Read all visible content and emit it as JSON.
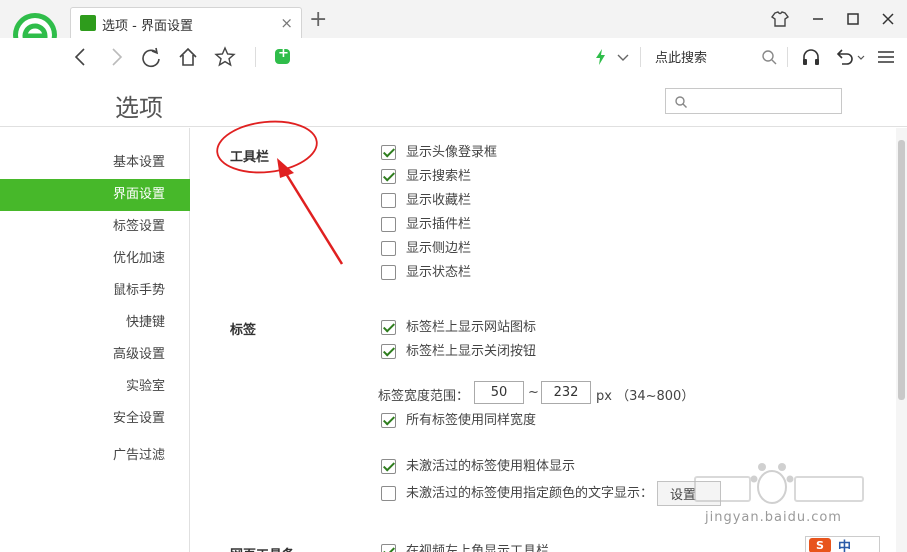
{
  "browser": {
    "tab_title": "选项 - 界面设置",
    "tab_close": "×",
    "new_tab": "+",
    "search_hint": "点此搜索"
  },
  "page": {
    "title": "选项",
    "search_placeholder": ""
  },
  "sidebar": {
    "items": [
      {
        "label": "基本设置",
        "active": false
      },
      {
        "label": "界面设置",
        "active": true
      },
      {
        "label": "标签设置",
        "active": false
      },
      {
        "label": "优化加速",
        "active": false
      },
      {
        "label": "鼠标手势",
        "active": false
      },
      {
        "label": "快捷键",
        "active": false
      },
      {
        "label": "高级设置",
        "active": false
      },
      {
        "label": "实验室",
        "active": false
      },
      {
        "label": "安全设置",
        "active": false
      },
      {
        "label": "广告过滤",
        "active": false
      }
    ]
  },
  "sections": {
    "toolbar": {
      "title": "工具栏",
      "options": [
        {
          "label": "显示头像登录框",
          "checked": true
        },
        {
          "label": "显示搜索栏",
          "checked": true
        },
        {
          "label": "显示收藏栏",
          "checked": false
        },
        {
          "label": "显示插件栏",
          "checked": false
        },
        {
          "label": "显示侧边栏",
          "checked": false
        },
        {
          "label": "显示状态栏",
          "checked": false
        }
      ]
    },
    "tabs": {
      "title": "标签",
      "options": [
        {
          "label": "标签栏上显示网站图标",
          "checked": true
        },
        {
          "label": "标签栏上显示关闭按钮",
          "checked": true
        }
      ],
      "width_range_label": "标签宽度范围：",
      "width_min": "50",
      "width_sep": "~",
      "width_max": "232",
      "width_unit": "px （34~800）",
      "same_width": {
        "label": "所有标签使用同样宽度",
        "checked": true
      },
      "bold_inactive": {
        "label": "未激活过的标签使用粗体显示",
        "checked": true
      },
      "color_inactive": {
        "label": "未激活过的标签使用指定颜色的文字显示：",
        "checked": false
      },
      "set_button": "设置"
    },
    "page_toolbar": {
      "title": "网页工具条",
      "option": {
        "label": "在视频左上角显示工具栏",
        "checked": true
      }
    }
  },
  "watermark": {
    "domain": "jingyan.baidu.com"
  },
  "ime": {
    "s_label": "S",
    "zh_label": "中"
  },
  "colors": {
    "accent_green": "#47b82a",
    "annotation_red": "#e02020"
  }
}
